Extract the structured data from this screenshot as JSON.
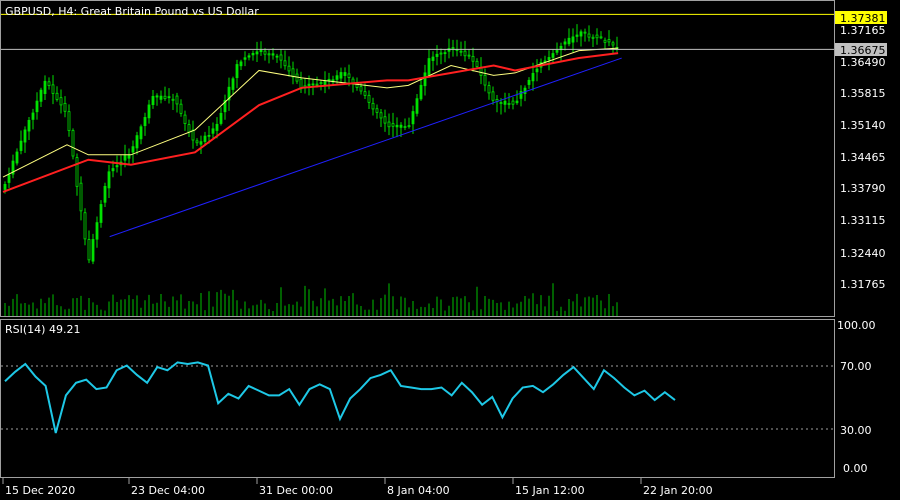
{
  "header": {
    "symbol_info": "GBPUSD, H4:  Great Britain Pound vs US Dollar"
  },
  "price_panel": {
    "y_ticks": [
      "1.37165",
      "1.36490",
      "1.35815",
      "1.35140",
      "1.34465",
      "1.33790",
      "1.33115",
      "1.32440",
      "1.31765"
    ],
    "levels": {
      "resistance": {
        "value": "1.37381",
        "color": "#ffff00"
      },
      "bid": {
        "value": "1.36675",
        "color": "#c0c0c0"
      }
    }
  },
  "rsi_panel": {
    "title": "RSI(14) 49.21",
    "y_ticks": [
      "100.00",
      "70.00",
      "30.00",
      "0.00"
    ],
    "line_color": "#1ec8e6"
  },
  "x_axis": {
    "labels": [
      "15 Dec 2020",
      "23 Dec 04:00",
      "31 Dec 00:00",
      "8 Jan 04:00",
      "15 Jan 12:00",
      "22 Jan 20:00"
    ]
  },
  "colors": {
    "background": "#000000",
    "candle": "#00e000",
    "volume": "#00c000",
    "ma_slow": "#ff2020",
    "ma_fast": "#ffff80",
    "trendline": "#2020ff",
    "grid": "#a0a0a0"
  },
  "chart_data": [
    {
      "type": "candlestick",
      "title": "GBPUSD, H4:  Great Britain Pound vs US Dollar",
      "ylim": [
        1.313,
        1.3765
      ],
      "series": [
        {
          "name": "Price",
          "anchors": [
            [
              "15 Dec",
              1.3385
            ],
            [
              "16 Dec",
              1.35
            ],
            [
              "17 Dec",
              1.3605
            ],
            [
              "18 Dec",
              1.3535
            ],
            [
              "21 Dec",
              1.3235
            ],
            [
              "21 Dec 12:00",
              1.334
            ],
            [
              "22 Dec",
              1.3425
            ],
            [
              "23 Dec",
              1.346
            ],
            [
              "24 Dec",
              1.357
            ],
            [
              "25 Dec",
              1.357
            ],
            [
              "28 Dec",
              1.3475
            ],
            [
              "29 Dec",
              1.351
            ],
            [
              "30 Dec",
              1.364
            ],
            [
              "31 Dec",
              1.3665
            ],
            [
              "1 Jan",
              1.365
            ],
            [
              "4 Jan",
              1.359
            ],
            [
              "5 Jan",
              1.36
            ],
            [
              "6 Jan",
              1.362
            ],
            [
              "7 Jan",
              1.357
            ],
            [
              "8 Jan",
              1.3515
            ],
            [
              "11 Jan",
              1.351
            ],
            [
              "12 Jan",
              1.365
            ],
            [
              "13 Jan",
              1.367
            ],
            [
              "14 Jan",
              1.365
            ],
            [
              "15 Jan",
              1.356
            ],
            [
              "18 Jan",
              1.356
            ],
            [
              "19 Jan",
              1.363
            ],
            [
              "20 Jan",
              1.367
            ],
            [
              "21 Jan",
              1.37
            ],
            [
              "22 Jan",
              1.369
            ],
            [
              "22 Jan 20:00",
              1.36675
            ]
          ]
        },
        {
          "name": "Moving Average (slow)",
          "anchors": [
            [
              "15 Dec",
              1.338
            ],
            [
              "21 Dec",
              1.3445
            ],
            [
              "23 Dec",
              1.3435
            ],
            [
              "28 Dec",
              1.346
            ],
            [
              "31 Dec",
              1.3555
            ],
            [
              "4 Jan",
              1.359
            ],
            [
              "8 Jan",
              1.3605
            ],
            [
              "11 Jan",
              1.3605
            ],
            [
              "15 Jan",
              1.3635
            ],
            [
              "18 Jan",
              1.3625
            ],
            [
              "21 Jan",
              1.365
            ],
            [
              "22 Jan 20:00",
              1.366
            ]
          ]
        },
        {
          "name": "Moving Average (fast)",
          "anchors": [
            [
              "15 Dec",
              1.341
            ],
            [
              "18 Dec",
              1.3475
            ],
            [
              "21 Dec",
              1.3455
            ],
            [
              "23 Dec",
              1.3455
            ],
            [
              "28 Dec",
              1.3505
            ],
            [
              "31 Dec",
              1.3625
            ],
            [
              "4 Jan",
              1.361
            ],
            [
              "8 Jan",
              1.359
            ],
            [
              "11 Jan",
              1.3595
            ],
            [
              "13 Jan",
              1.3635
            ],
            [
              "15 Jan",
              1.3615
            ],
            [
              "18 Jan",
              1.362
            ],
            [
              "21 Jan",
              1.3665
            ],
            [
              "22 Jan 20:00",
              1.367
            ]
          ]
        },
        {
          "name": "Trendline",
          "anchors": [
            [
              "22 Dec",
              1.329
            ],
            [
              "25 Jan",
              1.365
            ]
          ]
        }
      ],
      "levels": [
        1.37381,
        1.36675
      ]
    },
    {
      "type": "line",
      "title": "RSI(14) 49.21",
      "ylim": [
        0,
        100
      ],
      "levels": [
        70,
        30
      ],
      "series": [
        {
          "name": "RSI(14)",
          "values": [
            61,
            67,
            72,
            64,
            58,
            28,
            52,
            60,
            62,
            56,
            57,
            68,
            71,
            65,
            60,
            70,
            68,
            73,
            72,
            73,
            71,
            47,
            53,
            50,
            58,
            55,
            52,
            52,
            56,
            46,
            56,
            59,
            56,
            37,
            50,
            56,
            63,
            65,
            68,
            58,
            57,
            56,
            56,
            57,
            52,
            60,
            54,
            46,
            51,
            38,
            50,
            57,
            58,
            54,
            59,
            65,
            70,
            63,
            56,
            68,
            63,
            57,
            52,
            55,
            49,
            54,
            49
          ]
        }
      ]
    }
  ]
}
